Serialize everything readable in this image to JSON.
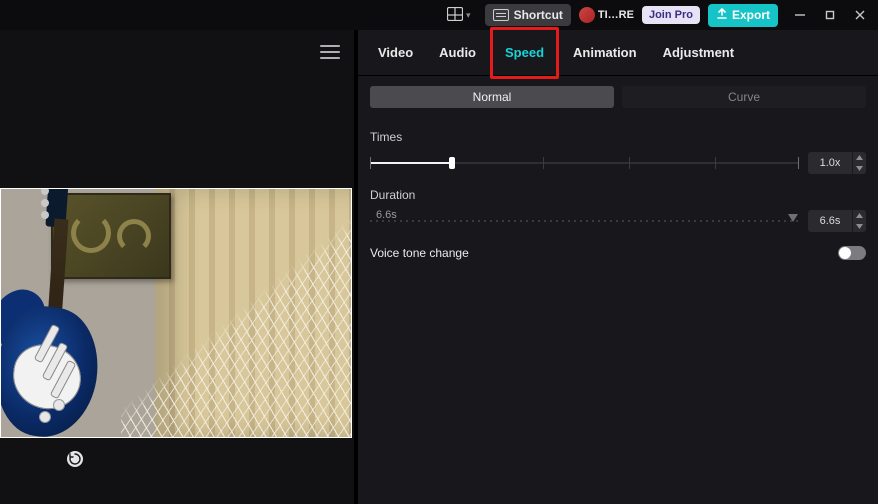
{
  "titlebar": {
    "shortcut_label": "Shortcut",
    "user_name": "TI…RE",
    "join_pro_label": "Join Pro",
    "export_label": "Export"
  },
  "tabs": {
    "video": "Video",
    "audio": "Audio",
    "speed": "Speed",
    "animation": "Animation",
    "adjustment": "Adjustment"
  },
  "subtabs": {
    "normal": "Normal",
    "curve": "Curve"
  },
  "speed_panel": {
    "times_label": "Times",
    "times_value": "1.0x",
    "duration_label": "Duration",
    "duration_track_text": "6.6s",
    "duration_value": "6.6s",
    "voice_tone_label": "Voice tone change",
    "voice_tone_on": false
  }
}
